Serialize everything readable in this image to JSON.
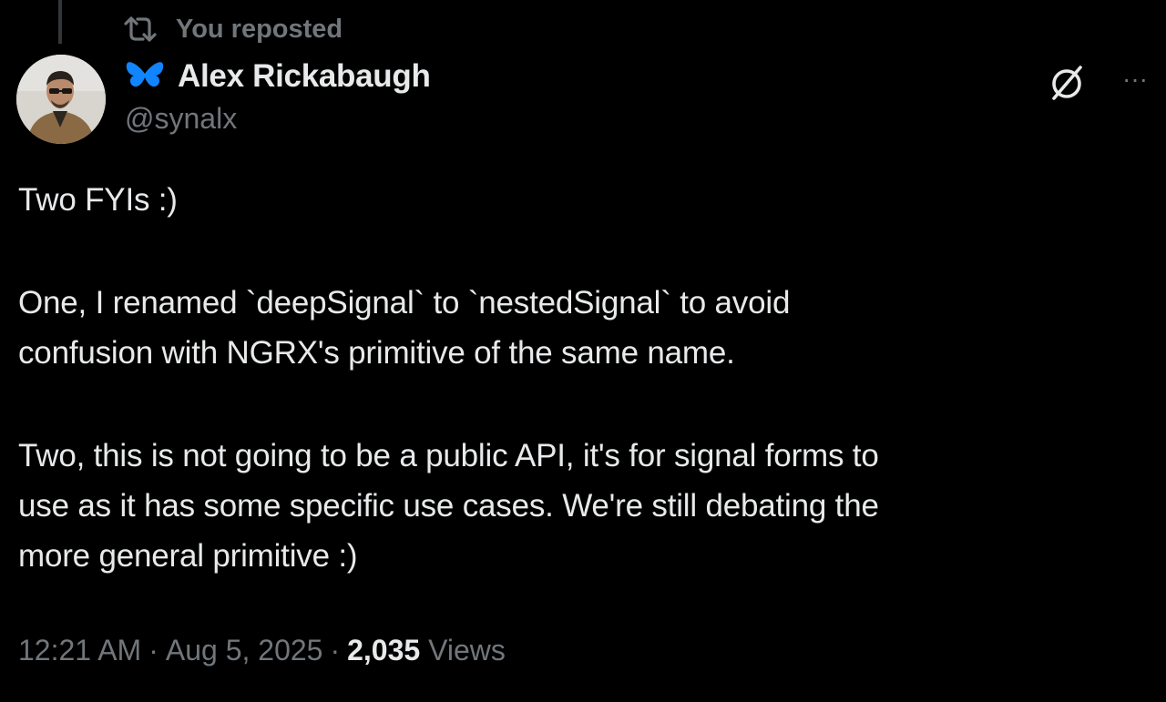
{
  "repost": {
    "label": "You reposted",
    "icon": "repost-icon"
  },
  "author": {
    "display_name": "Alex Rickabaugh",
    "handle": "@synalx",
    "badge_icon": "butterfly-icon",
    "avatar": "avatar-photo"
  },
  "actions": {
    "grok_icon": "grok-icon",
    "more_icon": "more-horizontal-icon",
    "more_label": "···"
  },
  "tweet": {
    "paragraphs": [
      "Two FYIs :)",
      "One, I renamed `deepSignal` to `nestedSignal` to avoid\nconfusion with NGRX's primitive of the same name.",
      "Two, this is not going to be a public API, it's for signal forms to\nuse as it has some specific use cases. We're still debating the\nmore general primitive :)"
    ]
  },
  "meta": {
    "time": "12:21 AM",
    "separator": "·",
    "date": "Aug 5, 2025",
    "views_count": "2,035",
    "views_label": "Views"
  },
  "colors": {
    "background": "#000000",
    "text_primary": "#e7e9ea",
    "text_secondary": "#71767b",
    "bluesky_blue": "#1185fe"
  }
}
